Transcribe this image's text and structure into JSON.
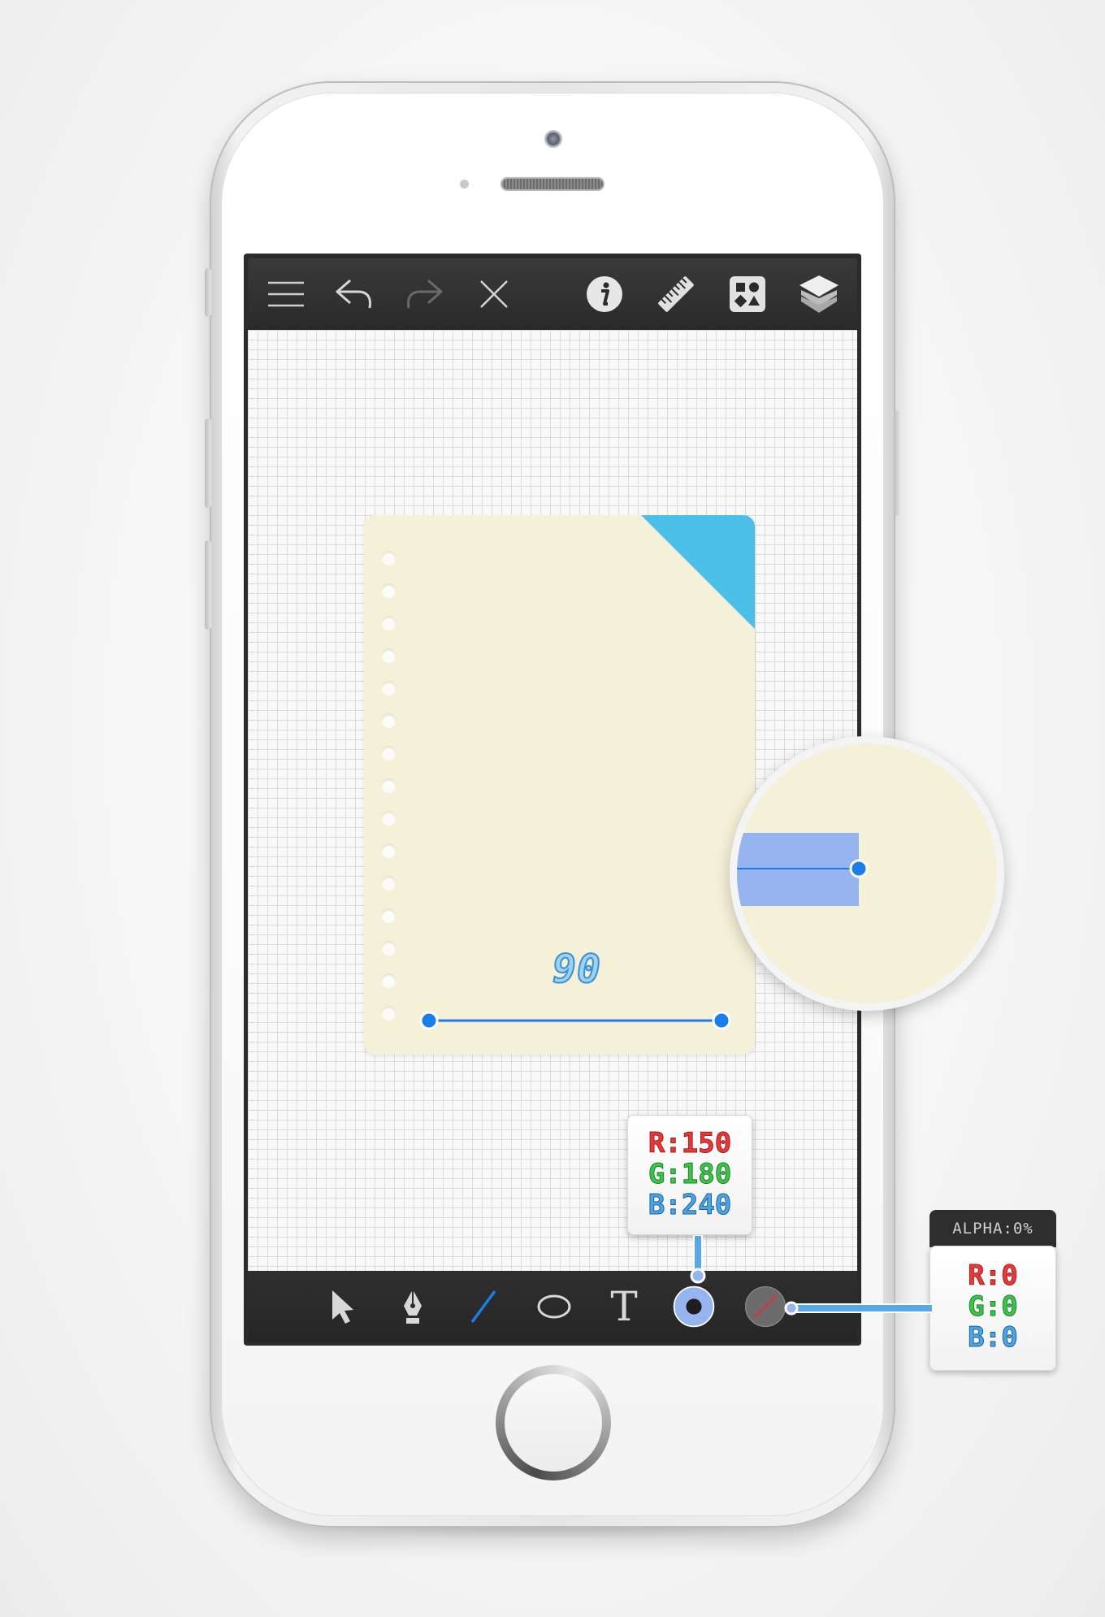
{
  "toolbar_top": {
    "icons": [
      "menu-icon",
      "undo-icon",
      "redo-icon",
      "close-icon",
      "info-icon",
      "ruler-icon",
      "shapes-icon",
      "layers-icon"
    ]
  },
  "toolbar_bottom": {
    "icons": [
      "select-arrow-icon",
      "pen-icon",
      "line-icon",
      "ellipse-icon",
      "text-icon",
      "fill-color-icon",
      "stroke-color-icon"
    ],
    "text_tool_glyph": "T",
    "active_tool": "line"
  },
  "canvas": {
    "measurement_label": "90"
  },
  "fill_popover": {
    "r": "R:150",
    "g": "G:180",
    "b": "B:240",
    "color": "#96b4f0"
  },
  "stroke_popover": {
    "alpha": "ALPHA:0%",
    "r": "R:0",
    "g": "G:0",
    "b": "B:0"
  },
  "colors": {
    "paper": "#f5f0d8",
    "corner": "#4bbfe8",
    "accent_blue": "#1a7ee8",
    "selection_fill": "#96b4f0"
  }
}
